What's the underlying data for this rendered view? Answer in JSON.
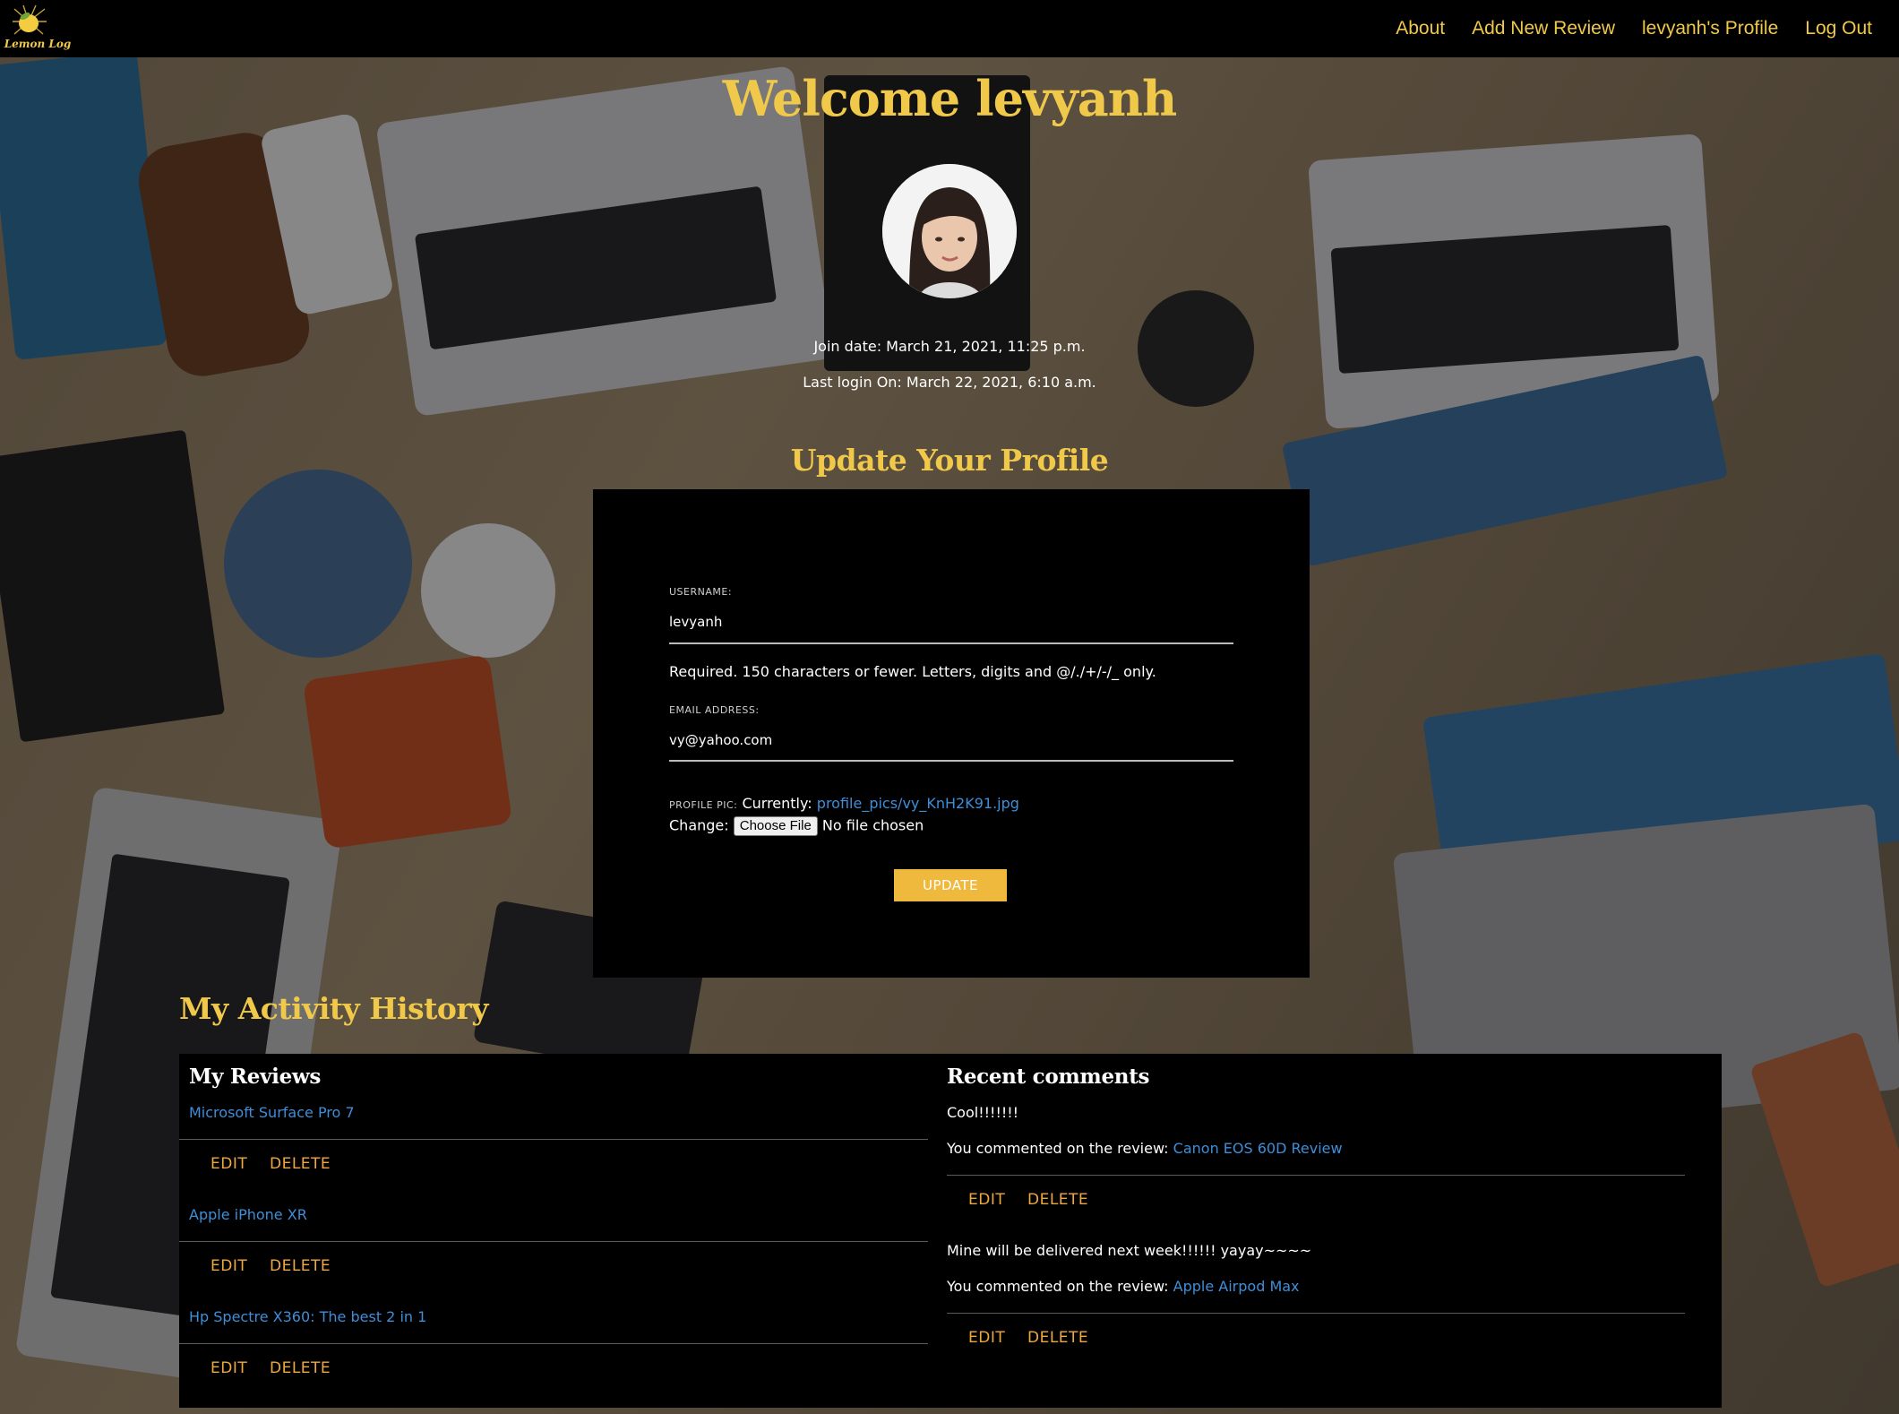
{
  "brand": {
    "name": "Lemon Log",
    "accent": "#f1c94a"
  },
  "nav": [
    {
      "label": "About"
    },
    {
      "label": "Add New Review"
    },
    {
      "label": "levyanh's Profile"
    },
    {
      "label": "Log Out"
    }
  ],
  "profile": {
    "welcome": "Welcome levyanh",
    "join_date": "Join date: March 21, 2021, 11:25 p.m.",
    "last_login": "Last login On: March 22, 2021, 6:10 a.m."
  },
  "form": {
    "heading": "Update Your Profile",
    "username_label": "USERNAME:",
    "username_value": "levyanh",
    "username_help": "Required. 150 characters or fewer. Letters, digits and @/./+/-/_ only.",
    "email_label": "EMAIL ADDRESS:",
    "email_value": "vy@yahoo.com",
    "pic_label": "PROFILE PIC:",
    "currently_label": "Currently:",
    "current_file": "profile_pics/vy_KnH2K91.jpg",
    "change_label": "Change:",
    "choose_file": "Choose File",
    "no_file": "No file chosen",
    "submit_label": "UPDATE"
  },
  "activity": {
    "heading": "My Activity History",
    "reviews_heading": "My Reviews",
    "reviews": [
      {
        "title": "Microsoft Surface Pro 7",
        "edit": "EDIT",
        "delete": "DELETE"
      },
      {
        "title": "Apple iPhone XR",
        "edit": "EDIT",
        "delete": "DELETE"
      },
      {
        "title": "Hp Spectre X360: The best 2 in 1",
        "edit": "EDIT",
        "delete": "DELETE"
      }
    ],
    "comments_heading": "Recent comments",
    "comments": [
      {
        "text": "Cool!!!!!!!",
        "prefix": "You commented on the review:",
        "review": "Canon EOS 60D Review",
        "edit": "EDIT",
        "delete": "DELETE"
      },
      {
        "text": "Mine will be delivered next week!!!!!! yayay~~~~",
        "prefix": "You commented on the review:",
        "review": "Apple Airpod Max",
        "edit": "EDIT",
        "delete": "DELETE"
      }
    ]
  }
}
